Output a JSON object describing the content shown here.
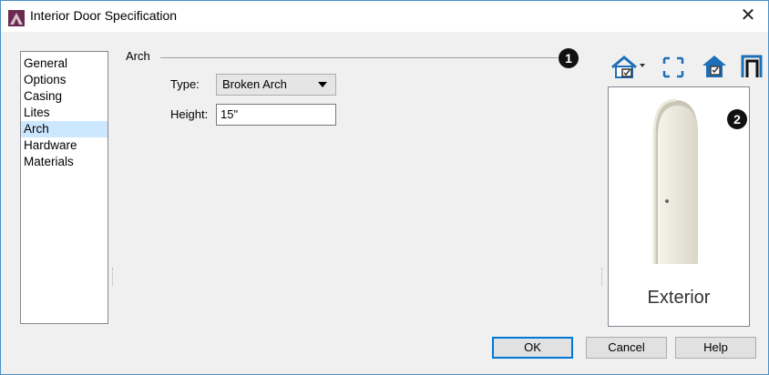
{
  "window": {
    "title": "Interior Door Specification",
    "close_glyph": "✕"
  },
  "nav": {
    "items": [
      {
        "label": "General"
      },
      {
        "label": "Options"
      },
      {
        "label": "Casing"
      },
      {
        "label": "Lites"
      },
      {
        "label": "Arch",
        "selected": true
      },
      {
        "label": "Hardware"
      },
      {
        "label": "Materials"
      }
    ]
  },
  "arch": {
    "group_label": "Arch",
    "type_label": "Type:",
    "type_value": "Broken Arch",
    "height_label": "Height:",
    "height_value": "15\""
  },
  "callouts": {
    "one": "1",
    "two": "2"
  },
  "preview": {
    "toolbar_icons": [
      "camera-view-icon",
      "fill-window-icon",
      "elevation-view-icon",
      "door-frame-icon"
    ],
    "caption": "Exterior",
    "door_color": "#e8e6dc"
  },
  "buttons": {
    "ok": "OK",
    "cancel": "Cancel",
    "help": "Help"
  },
  "colors": {
    "accent": "#0078d7",
    "selection": "#cce8ff",
    "window_border": "#4a90c8"
  }
}
